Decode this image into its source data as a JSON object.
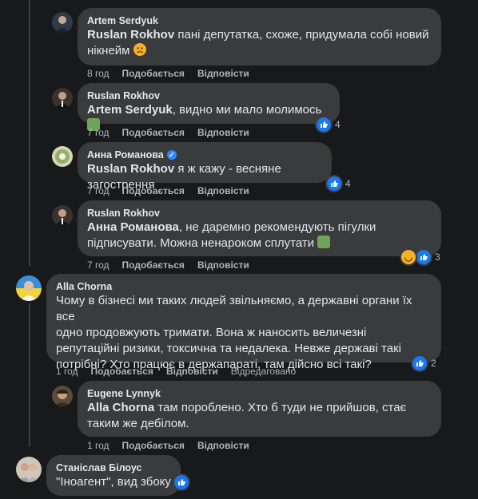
{
  "actions": {
    "like": "Подобається",
    "reply": "Відповісти"
  },
  "comments": [
    {
      "author": "Artem Serdyuk",
      "mention": "Ruslan Rokhov",
      "text_before": " пані депутатка, схоже, придумала собі новий",
      "text_line2": "нікнейм",
      "emoji": "sad-face",
      "time": "8 год"
    },
    {
      "author": "Ruslan Rokhov",
      "mention": "Artem Serdyuk",
      "text": ", видно ми мало молимось",
      "emoji": "praying",
      "time": "7 год",
      "likes": "4"
    },
    {
      "author": "Анна Романова",
      "verified": true,
      "mention": "Ruslan Rokhov",
      "text": " я ж кажу - весняне загострення",
      "time": "7 год",
      "likes": "4"
    },
    {
      "author": "Ruslan Rokhov",
      "mention": "Анна Романова",
      "text_line1": ", не даремно рекомендують пігулки",
      "text_line2": "підписувати. Можна ненароком сплутати",
      "emoji": "praying",
      "time": "7 год",
      "likes": "3"
    },
    {
      "author": "Alla Chorna",
      "lines": [
        "Чому в бізнесі ми таких людей звільняємо, а державні органи їх все",
        "одно продовжують тримати. Вона ж наносить величезні",
        "репутаційні ризики, токсична та недалека. Невже державі такі",
        "потрібні? Хто працює в держапараті, там дійсно всі такі?"
      ],
      "time": "1 год",
      "edited": "Відредаговано",
      "likes": "2"
    },
    {
      "author": "Eugene Lynnyk",
      "mention": "Alla Chorna",
      "text_line1": " там пороблено. Хто б туди не прийшов, стає",
      "text_line2": "таким же дебілом.",
      "time": "1 год"
    },
    {
      "author": "Станіслав Білоус",
      "text": "\"Іноагент\", вид збоку"
    }
  ]
}
